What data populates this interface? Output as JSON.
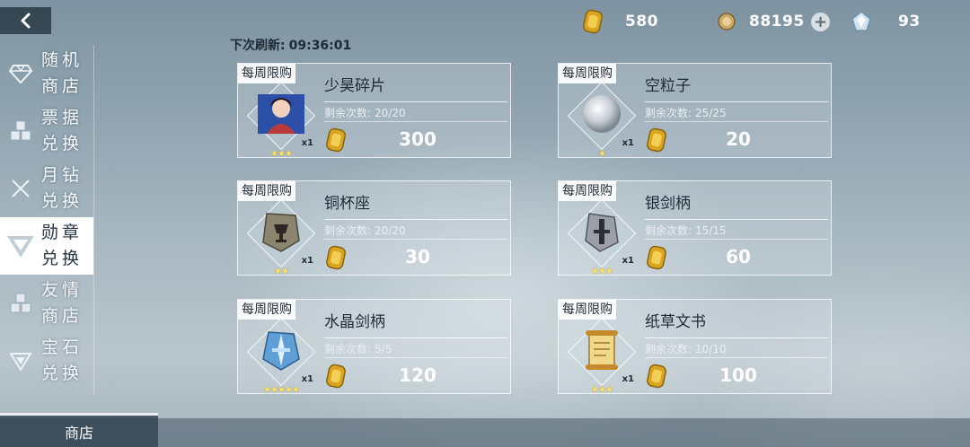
{
  "header": {
    "refresh_label": "下次刷新:",
    "refresh_time": "09:36:01"
  },
  "currencies": {
    "gold": "580",
    "coin": "88195",
    "gem": "93"
  },
  "sidebar": {
    "items": [
      {
        "line1": "随机",
        "line2": "商店",
        "icon": "diamond-gem-icon",
        "active": false
      },
      {
        "line1": "票据",
        "line2": "兑换",
        "icon": "cubes-icon",
        "active": false
      },
      {
        "line1": "月钻",
        "line2": "兑换",
        "icon": "crossed-swords-icon",
        "active": false
      },
      {
        "line1": "勋章",
        "line2": "兑换",
        "icon": "medal-emblem-icon",
        "active": true
      },
      {
        "line1": "友情",
        "line2": "商店",
        "icon": "cubes-icon",
        "active": false
      },
      {
        "line1": "宝石",
        "line2": "兑换",
        "icon": "gem-emblem-icon",
        "active": false
      }
    ]
  },
  "cards": [
    {
      "tag": "每周限购",
      "name": "少昊碎片",
      "remain_label": "剩余次数:",
      "remain": "20/20",
      "price": "300",
      "qty": "x1",
      "stars": "★★★",
      "art": "character-portrait-icon"
    },
    {
      "tag": "每周限购",
      "name": "空粒子",
      "remain_label": "剩余次数:",
      "remain": "25/25",
      "price": "20",
      "qty": "x1",
      "stars": "★",
      "art": "silver-orb-icon"
    },
    {
      "tag": "每周限购",
      "name": "铜杯座",
      "remain_label": "剩余次数:",
      "remain": "20/20",
      "price": "30",
      "qty": "x1",
      "stars": "★★",
      "art": "bronze-cup-icon"
    },
    {
      "tag": "每周限购",
      "name": "银剑柄",
      "remain_label": "剩余次数:",
      "remain": "15/15",
      "price": "60",
      "qty": "x1",
      "stars": "★★★",
      "art": "silver-hilt-icon"
    },
    {
      "tag": "每周限购",
      "name": "水晶剑柄",
      "remain_label": "剩余次数:",
      "remain": "5/5",
      "price": "120",
      "qty": "x1",
      "stars": "★★★★★",
      "art": "crystal-hilt-icon"
    },
    {
      "tag": "每周限购",
      "name": "纸草文书",
      "remain_label": "剩余次数:",
      "remain": "10/10",
      "price": "100",
      "qty": "x1",
      "stars": "★★★",
      "art": "papyrus-scroll-icon"
    }
  ],
  "bottom": {
    "tab_label": "商店"
  }
}
